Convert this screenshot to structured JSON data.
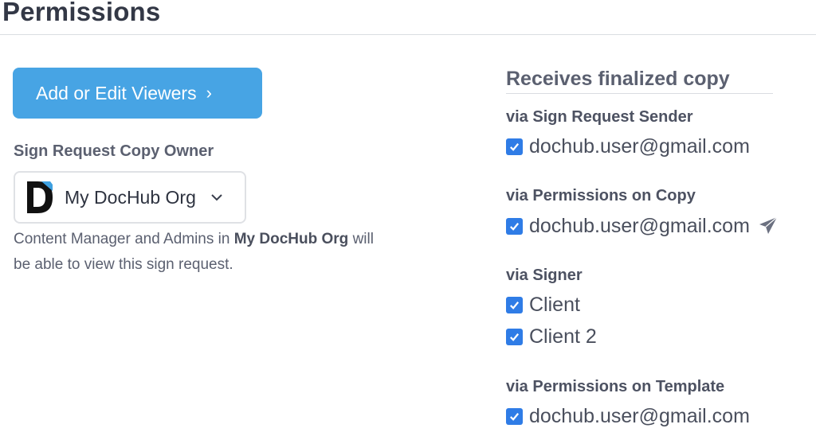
{
  "page": {
    "title": "Permissions"
  },
  "left": {
    "add_viewers_label": "Add or Edit Viewers",
    "add_viewers_chevron": "›",
    "owner_label": "Sign Request Copy Owner",
    "org_select": {
      "selected": "My DocHub Org",
      "logo_icon": "dochub-logo-icon",
      "chevron_icon": "chevron-down-icon"
    },
    "help": {
      "prefix": "Content Manager and Admins in ",
      "org": "My DocHub Org",
      "suffix": " will be able to view this sign request."
    }
  },
  "right": {
    "title": "Receives finalized copy",
    "groups": [
      {
        "label": "via Sign Request Sender",
        "items": [
          {
            "text": "dochub.user@gmail.com",
            "checked": true
          }
        ]
      },
      {
        "label": "via Permissions on Copy",
        "items": [
          {
            "text": "dochub.user@gmail.com",
            "checked": true,
            "action_icon": "send-icon"
          }
        ]
      },
      {
        "label": "via Signer",
        "items": [
          {
            "text": "Client",
            "checked": true
          },
          {
            "text": "Client 2",
            "checked": true
          }
        ]
      },
      {
        "label": "via Permissions on Template",
        "items": [
          {
            "text": "dochub.user@gmail.com",
            "checked": true
          }
        ]
      }
    ]
  },
  "colors": {
    "primary": "#47a4e4",
    "checkbox": "#2f7ce6",
    "text": "#4a4f5d"
  }
}
